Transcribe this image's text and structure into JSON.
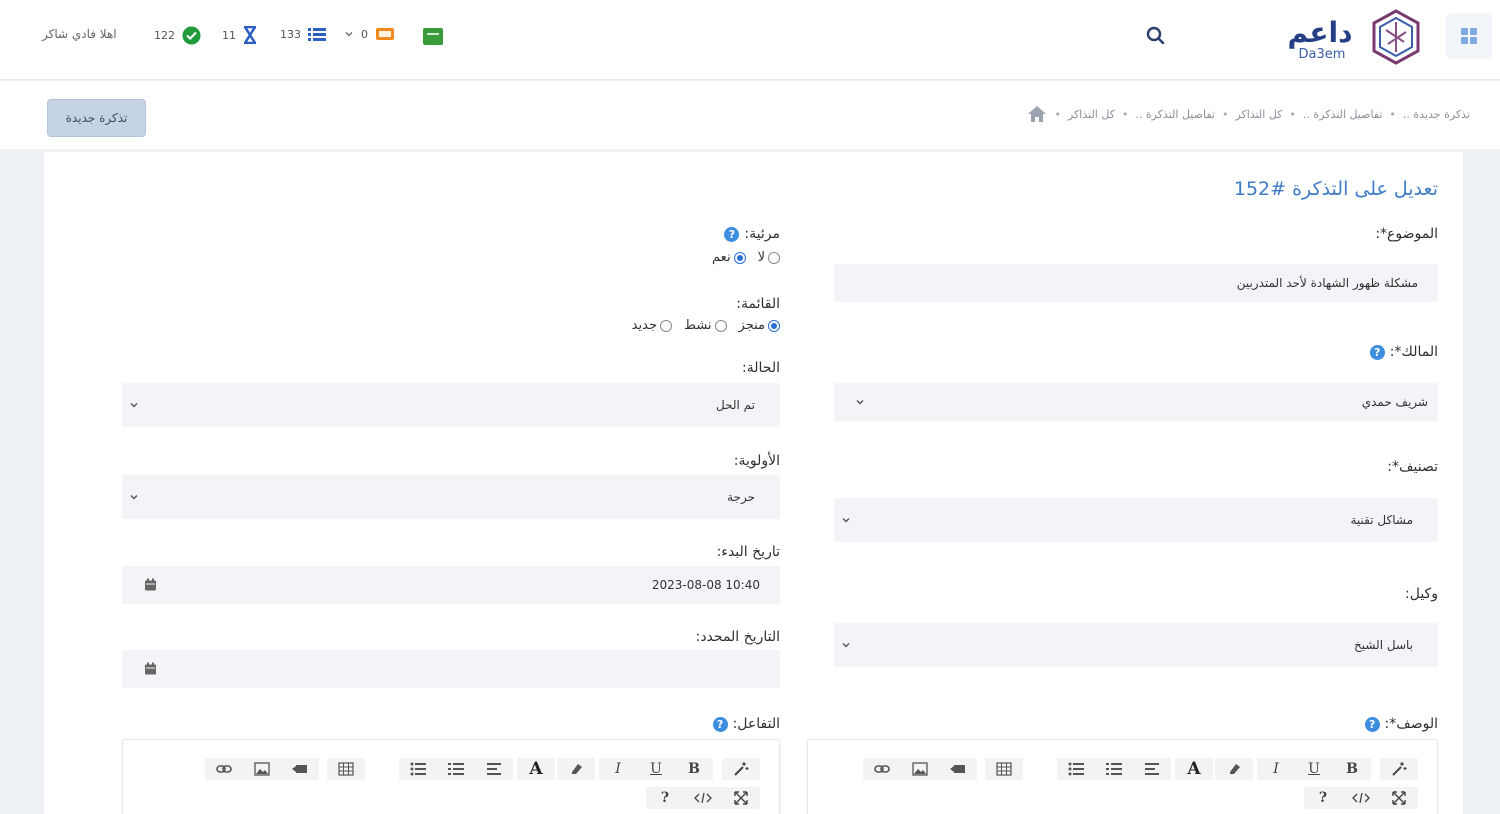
{
  "header": {
    "logo_text_ar": "داعم",
    "logo_text_en": "Da3em",
    "greeting": "اهلا فادي شاكر",
    "stats": [
      {
        "icon": "check-circle-icon",
        "count": "122",
        "color": "#1f9b3a"
      },
      {
        "icon": "hourglass-icon",
        "count": "11",
        "color": "#2b5fc4"
      },
      {
        "icon": "list-icon",
        "count": "133",
        "color": "#2b5fc4"
      },
      {
        "icon": "ticket-icon",
        "count": "0",
        "color": "#f08a1c"
      }
    ]
  },
  "toolbar": {
    "new_ticket_label": "تذكرة جديدة",
    "breadcrumbs": [
      "كل التذاكر",
      "تفاصيل التذكرة ..",
      "كل التذاكر",
      "تفاصيل التذكرة ..",
      "تذكرة جديدة .."
    ]
  },
  "form": {
    "title": "تعديل على التذكرة #152",
    "subject": {
      "label": "الموضوع*:",
      "value": "مشكلة ظهور الشهادة لأحد المتدربين"
    },
    "owner": {
      "label": "المالك*:",
      "value": "شريف حمدي"
    },
    "category": {
      "label": "تصنيف*:",
      "value": "مشاكل تقنية"
    },
    "agent": {
      "label": "وكيل:",
      "value": "باسل الشيخ"
    },
    "description": {
      "label": "الوصف*:"
    },
    "visible": {
      "label": "مرئية:",
      "options": [
        "نعم",
        "لا"
      ],
      "selected": "نعم"
    },
    "list": {
      "label": "القائمة:",
      "options": [
        "جديد",
        "نشط",
        "منجز"
      ],
      "selected": "منجز"
    },
    "status": {
      "label": "الحالة:",
      "value": "تم الحل"
    },
    "priority": {
      "label": "الأولوية:",
      "value": "حرجة"
    },
    "start_date": {
      "label": "تاريخ البدء:",
      "value": "2023-08-08 10:40"
    },
    "due_date": {
      "label": "التاريخ المحدد:",
      "value": ""
    },
    "interaction": {
      "label": "التفاعل:"
    }
  },
  "editor_toolbar": {
    "row1": [
      "magic-icon",
      "bold-icon",
      "underline-icon",
      "italic-icon",
      "eraser-icon",
      "font-color-icon",
      "unordered-list-icon",
      "ordered-list-icon",
      "align-icon",
      "table-icon",
      "link-icon",
      "picture-icon",
      "video-icon"
    ],
    "row2": [
      "fullscreen-icon",
      "code-view-icon",
      "help-icon"
    ],
    "bold": "B",
    "underline": "U",
    "italic": "I",
    "font_color": "A",
    "help": "?"
  },
  "colors": {
    "accent": "#3f7cc7",
    "help": "#3d8de0",
    "field_bg": "#f2f4f7"
  }
}
